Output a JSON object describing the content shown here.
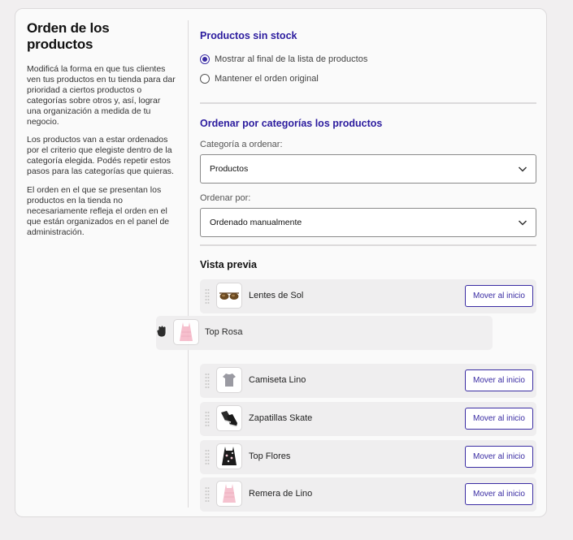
{
  "left": {
    "title": "Orden de los productos",
    "paragraphs": [
      "Modificá la forma en que tus clientes ven tus productos en tu tienda para dar prioridad a ciertos productos o categorías sobre otros y, así, lograr una organización a medida de tu negocio.",
      "Los productos van a estar ordenados por el criterio que elegiste dentro de la categoría elegida. Podés repetir estos pasos para las categorías que quieras.",
      "El orden en el que se presentan los productos en la tienda no necesariamente refleja el orden en el que están organizados en el panel de administración."
    ]
  },
  "stock": {
    "title": "Productos sin stock",
    "options": [
      {
        "label": "Mostrar al final de la lista de productos",
        "checked": true
      },
      {
        "label": "Mantener el orden original",
        "checked": false
      }
    ]
  },
  "categories": {
    "title": "Ordenar por categorías los productos",
    "category_label": "Categoría a ordenar:",
    "category_value": "Productos",
    "order_label": "Ordenar por:",
    "order_value": "Ordenado manualmente"
  },
  "preview": {
    "title": "Vista previa",
    "button_label": "Mover al inicio",
    "dragging_item": {
      "name": "Top Rosa",
      "icon": "pink-top-icon"
    },
    "items": [
      {
        "name": "Lentes de Sol",
        "icon": "sunglasses-icon"
      },
      {
        "name": "Camiseta Lino",
        "icon": "gray-tshirt-icon"
      },
      {
        "name": "Zapatillas Skate",
        "icon": "sneakers-icon"
      },
      {
        "name": "Top Flores",
        "icon": "floral-top-icon"
      },
      {
        "name": "Remera de Lino",
        "icon": "pink-tshirt-icon"
      }
    ]
  },
  "colors": {
    "accent": "#3a2ca3",
    "section_title": "#2b1b9e"
  }
}
